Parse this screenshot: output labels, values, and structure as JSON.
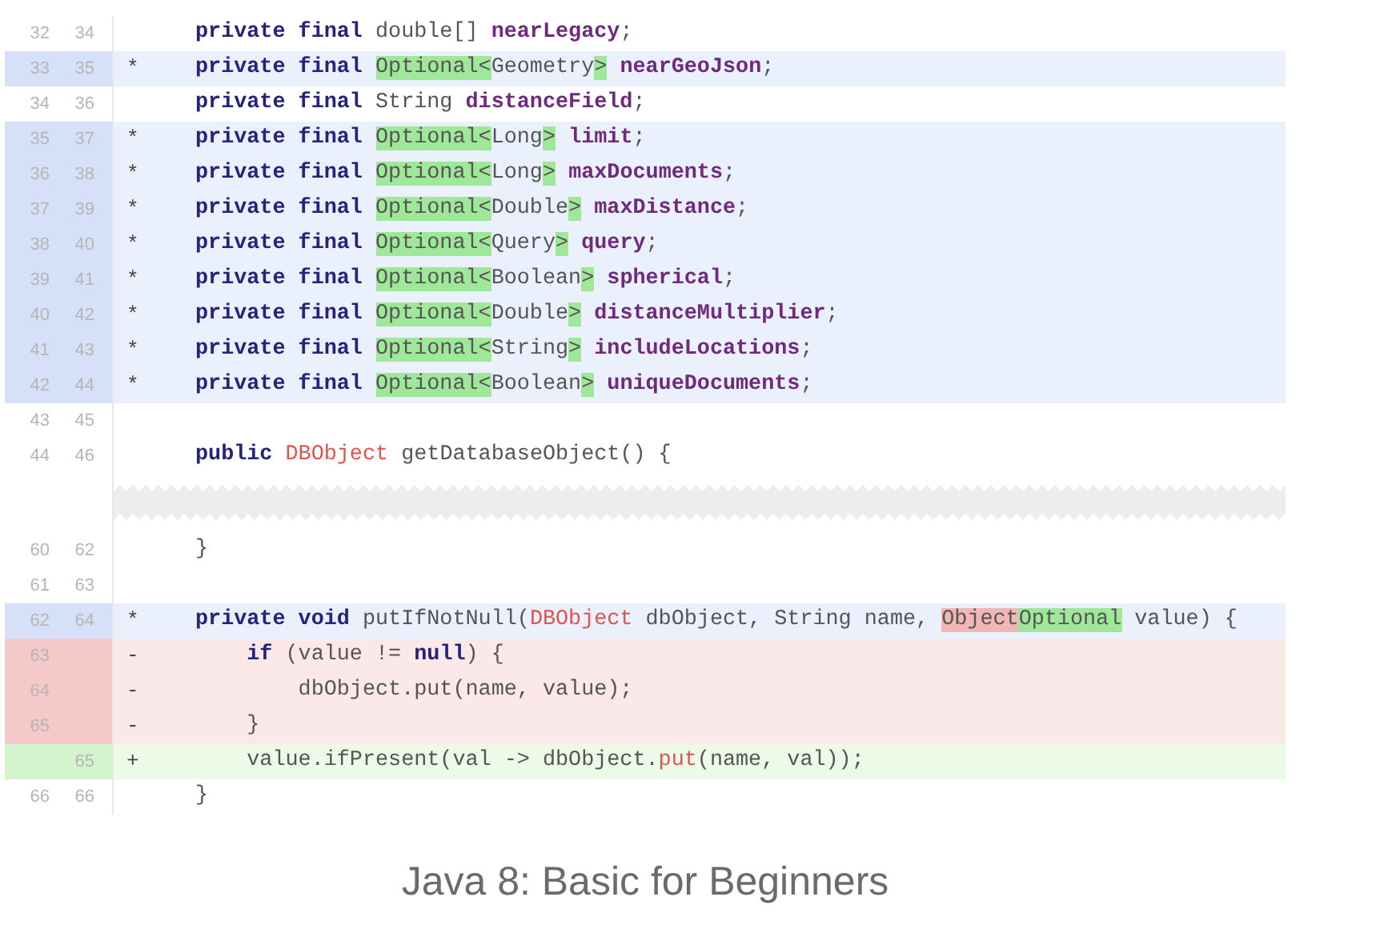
{
  "diff": {
    "rows": [
      {
        "kind": "context",
        "old": "32",
        "new": "34",
        "code": [
          {
            "kind": "kw",
            "t": "private final "
          },
          {
            "kind": "type",
            "t": "double[] "
          },
          {
            "kind": "field",
            "t": "nearLegacy"
          },
          {
            "kind": "plain",
            "t": ";"
          }
        ]
      },
      {
        "kind": "changed",
        "old": "33",
        "new": "35",
        "marker": "*",
        "code": [
          {
            "kind": "kw",
            "t": "private final "
          },
          {
            "kind": "add",
            "t": "Optional<"
          },
          {
            "kind": "type",
            "t": "Geometry"
          },
          {
            "kind": "add",
            "t": ">"
          },
          {
            "kind": "field",
            "t": " nearGeoJson"
          },
          {
            "kind": "plain",
            "t": ";"
          }
        ]
      },
      {
        "kind": "context",
        "old": "34",
        "new": "36",
        "code": [
          {
            "kind": "kw",
            "t": "private final "
          },
          {
            "kind": "type",
            "t": "String "
          },
          {
            "kind": "field",
            "t": "distanceField"
          },
          {
            "kind": "plain",
            "t": ";"
          }
        ]
      },
      {
        "kind": "changed",
        "old": "35",
        "new": "37",
        "marker": "*",
        "code": [
          {
            "kind": "kw",
            "t": "private final "
          },
          {
            "kind": "add",
            "t": "Optional<"
          },
          {
            "kind": "type",
            "t": "Long"
          },
          {
            "kind": "add",
            "t": ">"
          },
          {
            "kind": "field",
            "t": " limit"
          },
          {
            "kind": "plain",
            "t": ";"
          }
        ]
      },
      {
        "kind": "changed",
        "old": "36",
        "new": "38",
        "marker": "*",
        "code": [
          {
            "kind": "kw",
            "t": "private final "
          },
          {
            "kind": "add",
            "t": "Optional<"
          },
          {
            "kind": "type",
            "t": "Long"
          },
          {
            "kind": "add",
            "t": ">"
          },
          {
            "kind": "field",
            "t": " maxDocuments"
          },
          {
            "kind": "plain",
            "t": ";"
          }
        ]
      },
      {
        "kind": "changed",
        "old": "37",
        "new": "39",
        "marker": "*",
        "code": [
          {
            "kind": "kw",
            "t": "private final "
          },
          {
            "kind": "add",
            "t": "Optional<"
          },
          {
            "kind": "type",
            "t": "Double"
          },
          {
            "kind": "add",
            "t": ">"
          },
          {
            "kind": "field",
            "t": " maxDistance"
          },
          {
            "kind": "plain",
            "t": ";"
          }
        ]
      },
      {
        "kind": "changed",
        "old": "38",
        "new": "40",
        "marker": "*",
        "code": [
          {
            "kind": "kw",
            "t": "private final "
          },
          {
            "kind": "add",
            "t": "Optional<"
          },
          {
            "kind": "type",
            "t": "Query"
          },
          {
            "kind": "add",
            "t": ">"
          },
          {
            "kind": "field",
            "t": " query"
          },
          {
            "kind": "plain",
            "t": ";"
          }
        ]
      },
      {
        "kind": "changed",
        "old": "39",
        "new": "41",
        "marker": "*",
        "code": [
          {
            "kind": "kw",
            "t": "private final "
          },
          {
            "kind": "add",
            "t": "Optional<"
          },
          {
            "kind": "type",
            "t": "Boolean"
          },
          {
            "kind": "add",
            "t": ">"
          },
          {
            "kind": "field",
            "t": " spherical"
          },
          {
            "kind": "plain",
            "t": ";"
          }
        ]
      },
      {
        "kind": "changed",
        "old": "40",
        "new": "42",
        "marker": "*",
        "code": [
          {
            "kind": "kw",
            "t": "private final "
          },
          {
            "kind": "add",
            "t": "Optional<"
          },
          {
            "kind": "type",
            "t": "Double"
          },
          {
            "kind": "add",
            "t": ">"
          },
          {
            "kind": "field",
            "t": " distanceMultiplier"
          },
          {
            "kind": "plain",
            "t": ";"
          }
        ]
      },
      {
        "kind": "changed",
        "old": "41",
        "new": "43",
        "marker": "*",
        "code": [
          {
            "kind": "kw",
            "t": "private final "
          },
          {
            "kind": "add",
            "t": "Optional<"
          },
          {
            "kind": "type",
            "t": "String"
          },
          {
            "kind": "add",
            "t": ">"
          },
          {
            "kind": "field",
            "t": " includeLocations"
          },
          {
            "kind": "plain",
            "t": ";"
          }
        ]
      },
      {
        "kind": "changed",
        "old": "42",
        "new": "44",
        "marker": "*",
        "code": [
          {
            "kind": "kw",
            "t": "private final "
          },
          {
            "kind": "add",
            "t": "Optional<"
          },
          {
            "kind": "type",
            "t": "Boolean"
          },
          {
            "kind": "add",
            "t": ">"
          },
          {
            "kind": "field",
            "t": " uniqueDocuments"
          },
          {
            "kind": "plain",
            "t": ";"
          }
        ]
      },
      {
        "kind": "context",
        "old": "43",
        "new": "45"
      },
      {
        "kind": "context",
        "old": "44",
        "new": "46",
        "code": [
          {
            "kind": "kw",
            "t": "public "
          },
          {
            "kind": "ref",
            "t": "DBObject"
          },
          {
            "kind": "plain",
            "t": " getDatabaseObject() {"
          }
        ]
      },
      {
        "kind": "fold"
      },
      {
        "kind": "context",
        "old": "60",
        "new": "62",
        "code": [
          {
            "kind": "plain",
            "t": "}"
          }
        ]
      },
      {
        "kind": "context",
        "old": "61",
        "new": "63"
      },
      {
        "kind": "changed",
        "old": "62",
        "new": "64",
        "marker": "*",
        "code": [
          {
            "kind": "kw",
            "t": "private void "
          },
          {
            "kind": "plain",
            "t": "putIfNotNull("
          },
          {
            "kind": "ref",
            "t": "DBObject"
          },
          {
            "kind": "plain",
            "t": " dbObject, String name, "
          },
          {
            "kind": "del",
            "t": "Object"
          },
          {
            "kind": "add",
            "t": "Optional"
          },
          {
            "kind": "plain",
            "t": " value) {"
          }
        ]
      },
      {
        "kind": "removed",
        "old": "63",
        "marker": "-",
        "code": [
          {
            "kind": "kw",
            "t": "    if"
          },
          {
            "kind": "plain",
            "t": " (value != "
          },
          {
            "kind": "kw",
            "t": "null"
          },
          {
            "kind": "plain",
            "t": ") {"
          }
        ]
      },
      {
        "kind": "removed",
        "old": "64",
        "marker": "-",
        "code": [
          {
            "kind": "plain",
            "t": "        dbObject.put(name, value);"
          }
        ]
      },
      {
        "kind": "removed",
        "old": "65",
        "marker": "-",
        "code": [
          {
            "kind": "plain",
            "t": "    }"
          }
        ]
      },
      {
        "kind": "added",
        "new": "65",
        "marker": "+",
        "code": [
          {
            "kind": "plain",
            "t": "    value.ifPresent(val -> dbObject."
          },
          {
            "kind": "ref",
            "t": "put"
          },
          {
            "kind": "plain",
            "t": "(name, val));"
          }
        ]
      },
      {
        "kind": "context",
        "old": "66",
        "new": "66",
        "code": [
          {
            "kind": "plain",
            "t": "}"
          }
        ]
      }
    ]
  },
  "caption": "Java 8: Basic for Beginners"
}
